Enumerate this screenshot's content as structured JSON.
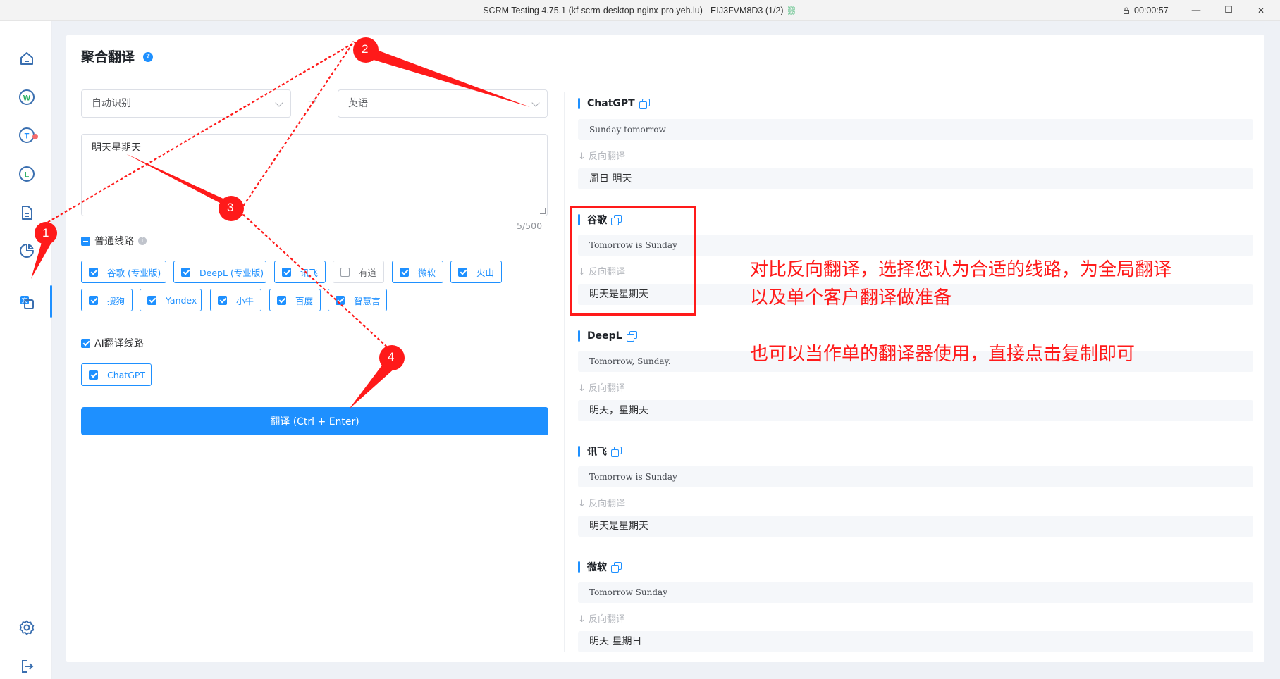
{
  "window": {
    "title": "SCRM Testing 4.75.1 (kf-scrm-desktop-nginx-pro.yeh.lu) - EIJ3FVM8D3 (1/2)",
    "timer": "00:00:57",
    "minimize": "—",
    "maximize": "☐",
    "close": "✕"
  },
  "page": {
    "title": "聚合翻译",
    "help": "?"
  },
  "translator": {
    "source_lang": "自动识别",
    "target_lang": "英语",
    "swap_arrow": "→",
    "input_text": "明天星期天",
    "char_count": "5/500",
    "normal_group_label": "普通线路",
    "ai_group_label": "AI翻译线路",
    "normal_engines": [
      {
        "label": "谷歌 (专业版)",
        "checked": true
      },
      {
        "label": "DeepL (专业版)",
        "checked": true
      },
      {
        "label": "讯飞",
        "checked": true
      },
      {
        "label": "有道",
        "checked": false
      },
      {
        "label": "微软",
        "checked": true
      },
      {
        "label": "火山",
        "checked": true
      },
      {
        "label": "搜狗",
        "checked": true
      },
      {
        "label": "Yandex",
        "checked": true
      },
      {
        "label": "小牛",
        "checked": true
      },
      {
        "label": "百度",
        "checked": true
      },
      {
        "label": "智慧言",
        "checked": true
      }
    ],
    "ai_engines": [
      {
        "label": "ChatGPT",
        "checked": true
      }
    ],
    "translate_button": "翻译 (Ctrl + Enter)"
  },
  "results": [
    {
      "engine": "ChatGPT",
      "translation": "Sunday tomorrow",
      "reverse_label": "反向翻译",
      "reverse": "周日 明天"
    },
    {
      "engine": "谷歌",
      "translation": "Tomorrow is Sunday",
      "reverse_label": "反向翻译",
      "reverse": "明天是星期天"
    },
    {
      "engine": "DeepL",
      "translation": "Tomorrow, Sunday.",
      "reverse_label": "反向翻译",
      "reverse": "明天，星期天"
    },
    {
      "engine": "讯飞",
      "translation": "Tomorrow is Sunday",
      "reverse_label": "反向翻译",
      "reverse": "明天是星期天"
    },
    {
      "engine": "微软",
      "translation": "Tomorrow Sunday",
      "reverse_label": "反向翻译",
      "reverse": "明天 星期日"
    }
  ],
  "annotations": {
    "line1": "对比反向翻译，选择您认为合适的线路，为全局翻译",
    "line2": "以及单个客户翻译做准备",
    "line3": "也可以当作单的翻译器使用，直接点击复制即可",
    "markers": [
      "1",
      "2",
      "3",
      "4"
    ],
    "color": "#ff1a1a"
  },
  "colors": {
    "accent": "#1e90ff",
    "content_bg": "#eef1f6",
    "annotation": "#ff1a1a"
  },
  "nav_icons": [
    "home-icon",
    "whatsapp-icon",
    "telegram-icon",
    "line-icon",
    "document-icon",
    "statistics-icon",
    "translate-icon",
    "settings-icon",
    "logout-icon"
  ]
}
